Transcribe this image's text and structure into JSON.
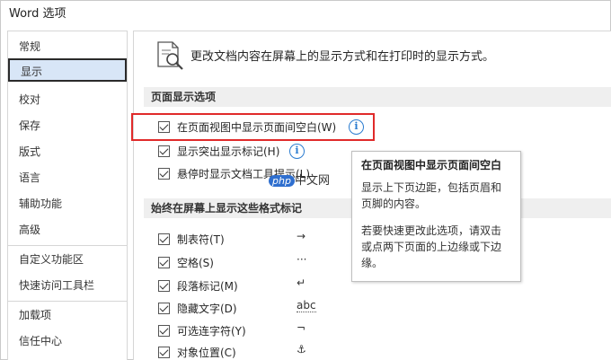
{
  "window": {
    "title": "Word 选项"
  },
  "sidebar": {
    "items": [
      {
        "label": "常规"
      },
      {
        "label": "显示"
      },
      {
        "label": "校对"
      },
      {
        "label": "保存"
      },
      {
        "label": "版式"
      },
      {
        "label": "语言"
      },
      {
        "label": "辅助功能"
      },
      {
        "label": "高级"
      },
      {
        "label": "自定义功能区"
      },
      {
        "label": "快速访问工具栏"
      },
      {
        "label": "加载项"
      },
      {
        "label": "信任中心"
      }
    ],
    "selected": "显示"
  },
  "content": {
    "description": "更改文档内容在屏幕上的显示方式和在打印时的显示方式。",
    "page_display_section": {
      "title": "页面显示选项",
      "options": [
        {
          "label": "在页面视图中显示页面间空白(W)",
          "checked": true
        },
        {
          "label": "显示突出显示标记(H)",
          "checked": true
        },
        {
          "label": "悬停时显示文档工具提示(L)",
          "checked": true
        }
      ]
    },
    "format_marks_section": {
      "title": "始终在屏幕上显示这些格式标记",
      "options": [
        {
          "label": "制表符(T)",
          "checked": true,
          "mark": "→"
        },
        {
          "label": "空格(S)",
          "checked": true,
          "mark": "···"
        },
        {
          "label": "段落标记(M)",
          "checked": true,
          "mark": "↵"
        },
        {
          "label": "隐藏文字(D)",
          "checked": true,
          "mark": "abc"
        },
        {
          "label": "可选连字符(Y)",
          "checked": true,
          "mark": "¬"
        },
        {
          "label": "对象位置(C)",
          "checked": true,
          "mark": "⚓"
        }
      ]
    }
  },
  "tooltip": {
    "title": "在页面视图中显示页面间空白",
    "text1": "显示上下页边距，包括页眉和页脚的内容。",
    "text2": "若要快速更改此选项，请双击或点两下页面的上边缘或下边缘。"
  },
  "watermark": {
    "badge": "php",
    "text": "中文网"
  },
  "colors": {
    "accent": "#2b7cd0",
    "highlight": "#e02a2a",
    "selected_bg": "#d8e6f7"
  }
}
